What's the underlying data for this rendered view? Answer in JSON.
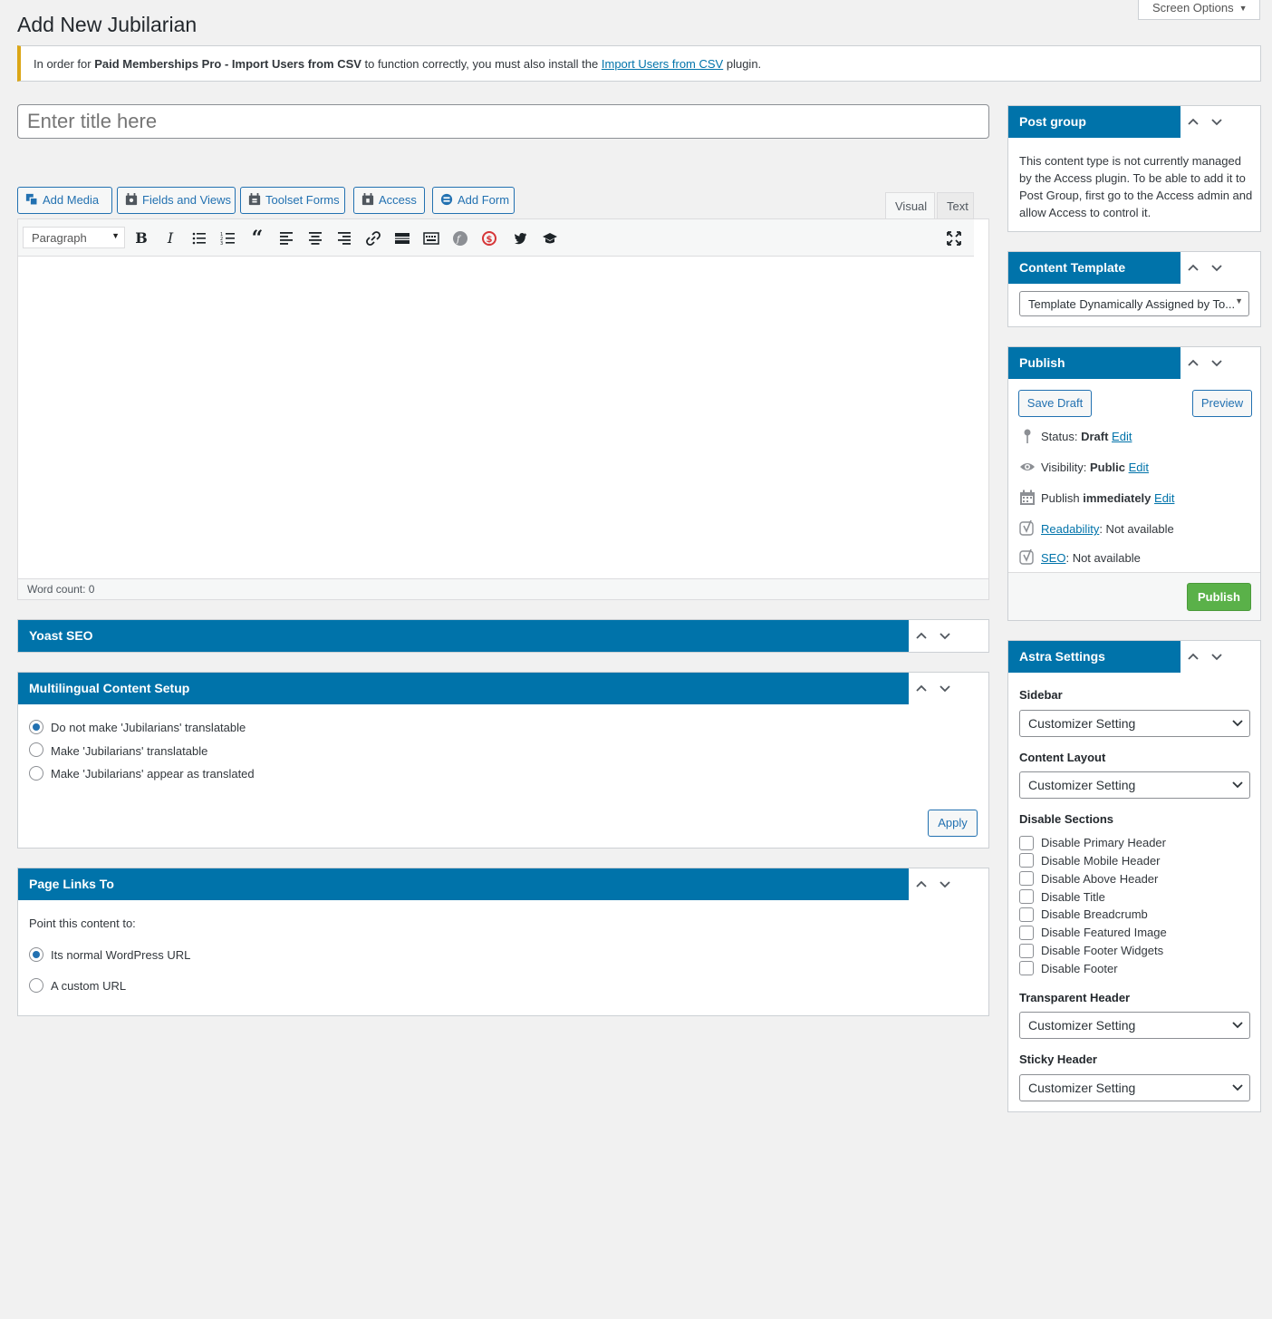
{
  "header": {
    "screen_options": "Screen Options",
    "page_title": "Add New Jubilarian"
  },
  "notice": {
    "prefix": "In order for ",
    "plugin": "Paid Memberships Pro - Import Users from CSV",
    "middle": " to function correctly, you must also install the ",
    "link": "Import Users from CSV",
    "suffix": " plugin."
  },
  "title_field": {
    "placeholder": "Enter title here"
  },
  "media_buttons": {
    "add_media": "Add Media",
    "fields_views": "Fields and Views",
    "toolset_forms": "Toolset Forms",
    "access": "Access",
    "add_form": "Add Form"
  },
  "editor": {
    "tabs": {
      "visual": "Visual",
      "text": "Text"
    },
    "format_select": "Paragraph",
    "word_count": "Word count: 0",
    "accent": "#0073aa"
  },
  "yoast": {
    "title": "Yoast SEO"
  },
  "multilingual": {
    "title": "Multilingual Content Setup",
    "options": [
      "Do not make 'Jubilarians' translatable",
      "Make 'Jubilarians' translatable",
      "Make 'Jubilarians' appear as translated"
    ],
    "selected_index": 0,
    "apply": "Apply"
  },
  "page_links": {
    "title": "Page Links To",
    "intro": "Point this content to:",
    "options": [
      "Its normal WordPress URL",
      "A custom URL"
    ],
    "selected_index": 0
  },
  "post_group": {
    "title": "Post group",
    "text": "This content type is not currently managed by the Access plugin. To be able to add it to Post Group, first go to the Access admin and allow Access to control it."
  },
  "content_template": {
    "title": "Content Template",
    "selected": "Template Dynamically Assigned by To..."
  },
  "publish": {
    "title": "Publish",
    "save_draft": "Save Draft",
    "preview": "Preview",
    "status_label": "Status: ",
    "status_value": "Draft",
    "visibility_label": "Visibility: ",
    "visibility_value": "Public",
    "publish_label": "Publish ",
    "publish_value": "immediately",
    "edit": "Edit",
    "readability_link": "Readability",
    "readability_value": ": Not available",
    "seo_link": "SEO",
    "seo_value": ": Not available",
    "publish_button": "Publish",
    "publish_color": "#5ab149"
  },
  "astra": {
    "title": "Astra Settings",
    "sidebar_label": "Sidebar",
    "sidebar_value": "Customizer Setting",
    "content_layout_label": "Content Layout",
    "content_layout_value": "Customizer Setting",
    "disable_sections_label": "Disable Sections",
    "disable_sections": [
      "Disable Primary Header",
      "Disable Mobile Header",
      "Disable Above Header",
      "Disable Title",
      "Disable Breadcrumb",
      "Disable Featured Image",
      "Disable Footer Widgets",
      "Disable Footer"
    ],
    "transparent_header_label": "Transparent Header",
    "transparent_header_value": "Customizer Setting",
    "sticky_header_label": "Sticky Header",
    "sticky_header_value": "Customizer Setting"
  }
}
